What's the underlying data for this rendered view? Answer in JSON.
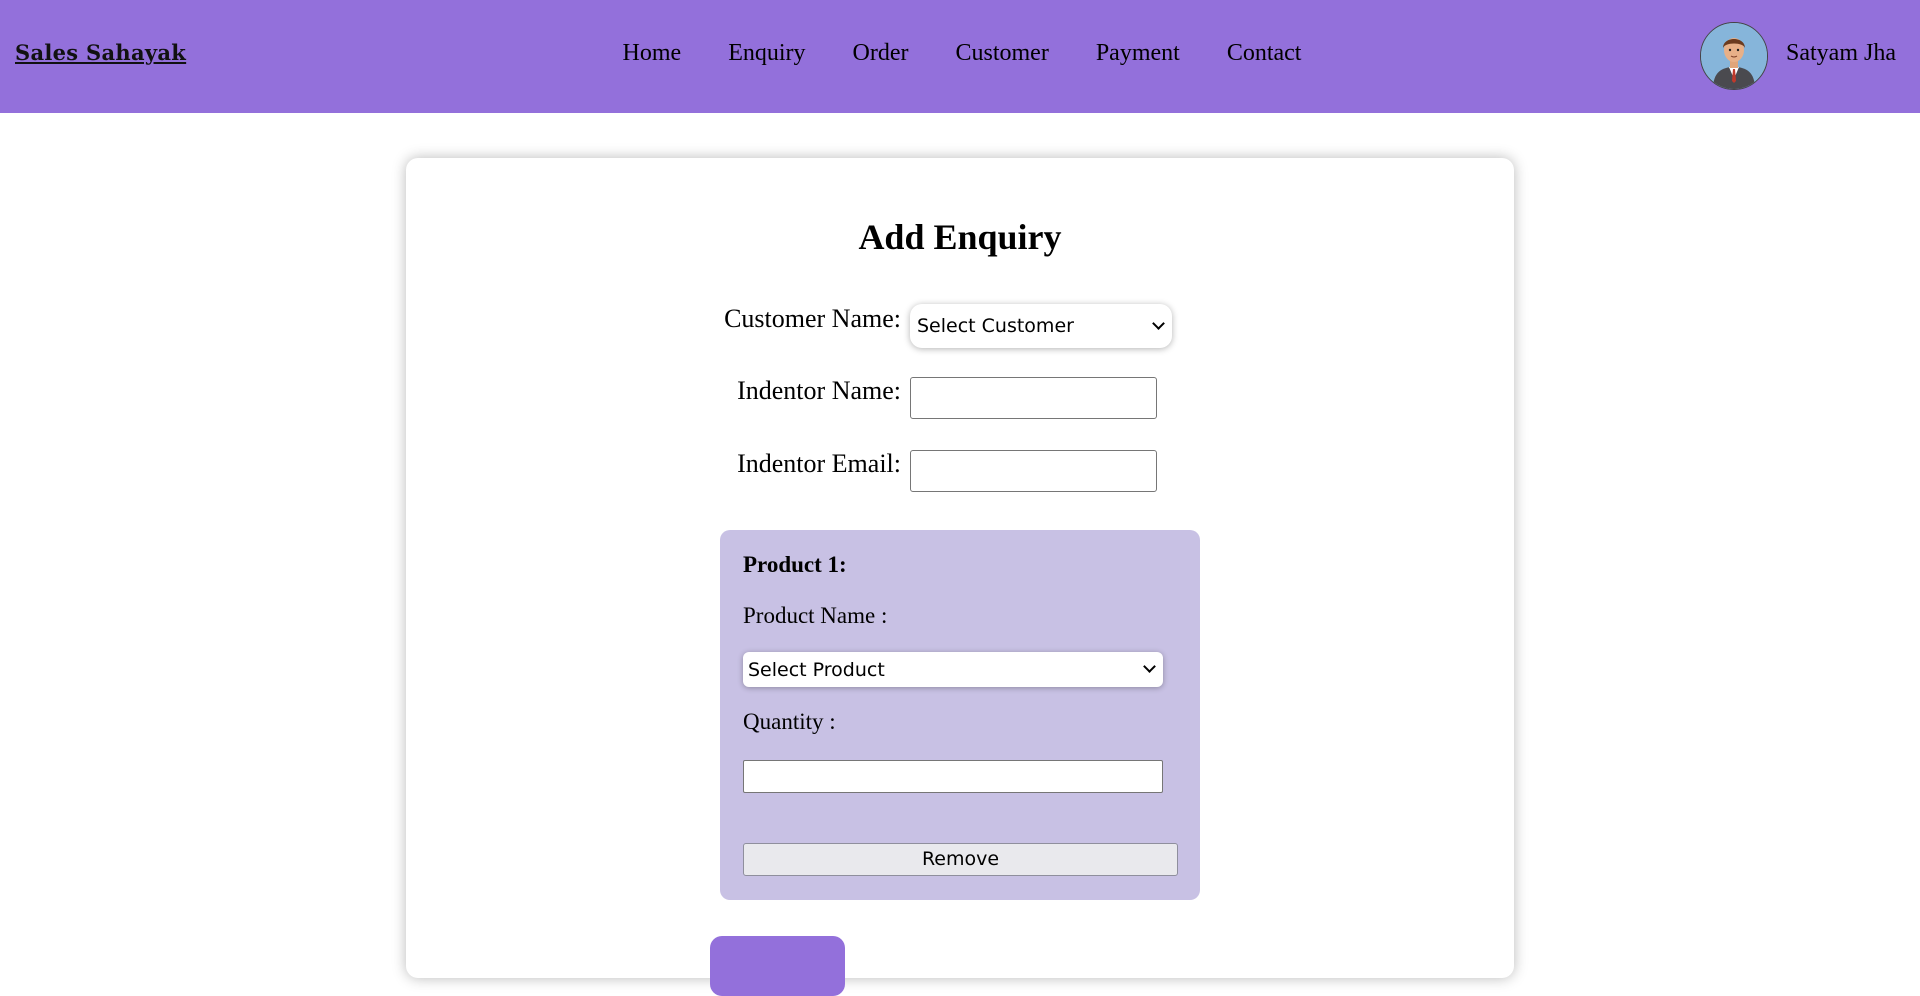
{
  "header": {
    "brand": "Sales Sahayak",
    "nav": [
      "Home",
      "Enquiry",
      "Order",
      "Customer",
      "Payment",
      "Contact"
    ],
    "user_name": "Satyam Jha"
  },
  "form": {
    "title": "Add Enquiry",
    "customer_label": "Customer Name:",
    "customer_select": "Select Customer",
    "indentor_name_label": "Indentor Name:",
    "indentor_name_value": "",
    "indentor_email_label": "Indentor Email:",
    "indentor_email_value": "",
    "product": {
      "heading": "Product 1:",
      "name_label": "Product Name :",
      "name_select": "Select Product",
      "quantity_label": "Quantity :",
      "quantity_value": "",
      "remove_label": "Remove"
    }
  },
  "colors": {
    "navbar": "#9370db",
    "product_panel": "#c8c1e4"
  }
}
